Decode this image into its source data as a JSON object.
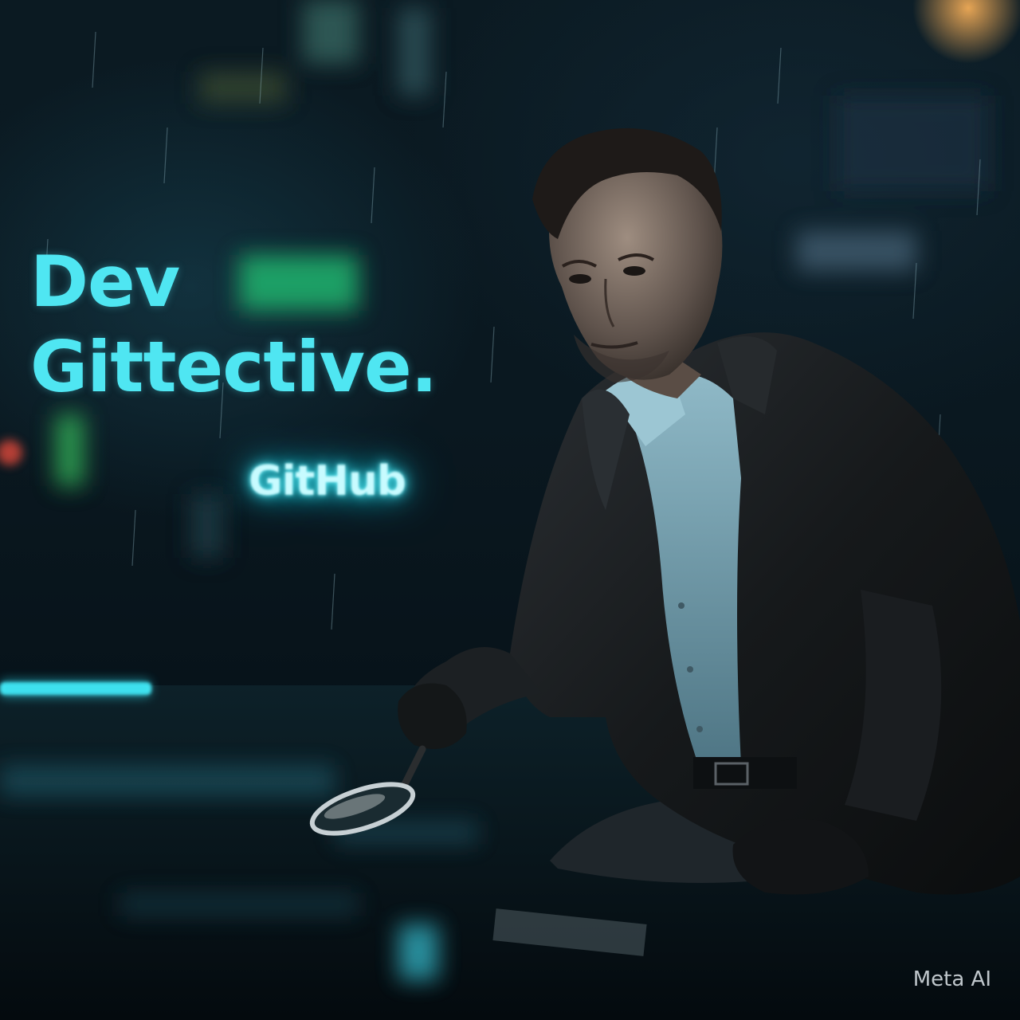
{
  "image": {
    "description_alt": "Detective in rain at night examining the wet street with a magnifying glass",
    "headline_line1": "Dev",
    "headline_line2": "Gittective.",
    "neon_sign_text": "GitHub",
    "watermark_text": "Meta AI"
  },
  "colors": {
    "headline": "#4fe6f2",
    "neon_glow": "#38e4f2",
    "background_dark": "#05090d",
    "jacket": "#1a1c1e",
    "shirt": "#7aa5b5"
  },
  "icons": [
    "magnifying-glass-icon"
  ]
}
